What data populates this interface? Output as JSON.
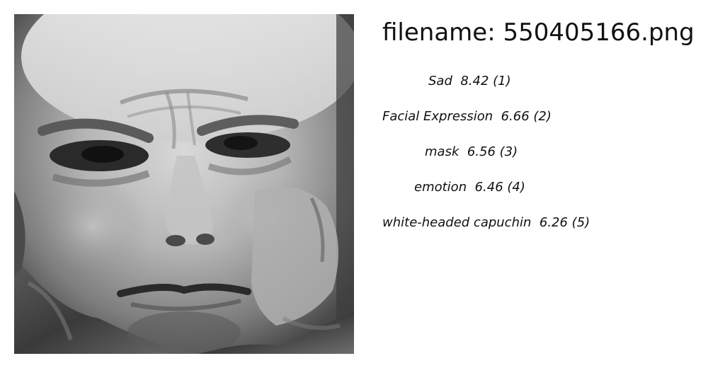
{
  "image": {
    "description_icon": "face-photo-icon"
  },
  "filename_label": "filename: 550405166.png",
  "labels": [
    {
      "name": "Sad",
      "score": "8.42",
      "rank": "(1)"
    },
    {
      "name": "Facial Expression",
      "score": "6.66",
      "rank": "(2)"
    },
    {
      "name": "mask",
      "score": "6.56",
      "rank": "(3)"
    },
    {
      "name": "emotion",
      "score": "6.46",
      "rank": "(4)"
    },
    {
      "name": "white-headed capuchin",
      "score": "6.26",
      "rank": "(5)"
    }
  ]
}
